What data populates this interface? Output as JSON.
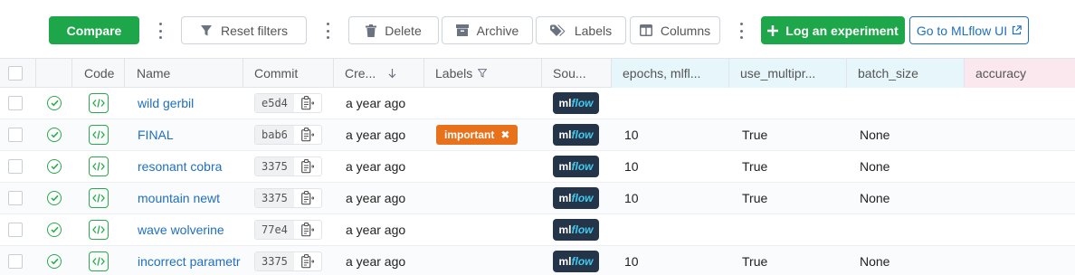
{
  "toolbar": {
    "compare": "Compare",
    "reset_filters": "Reset filters",
    "delete": "Delete",
    "archive": "Archive",
    "labels": "Labels",
    "columns": "Columns",
    "log_experiment": "Log an experiment",
    "go_mlflow": "Go to MLflow UI"
  },
  "columns": {
    "code": "Code",
    "name": "Name",
    "commit": "Commit",
    "created": "Cre...",
    "labels": "Labels",
    "source": "Sou...",
    "epochs": "epochs, mlfl...",
    "use_multi": "use_multipr...",
    "batch_size": "batch_size",
    "accuracy": "accuracy"
  },
  "rows": [
    {
      "name": "wild gerbil",
      "commit": "e5d4",
      "created": "a year ago",
      "label": "",
      "epochs": "",
      "use_multi": "",
      "batch_size": "",
      "accuracy": ""
    },
    {
      "name": "FINAL",
      "commit": "bab6",
      "created": "a year ago",
      "label": "important",
      "epochs": "10",
      "use_multi": "True",
      "batch_size": "None",
      "accuracy": ""
    },
    {
      "name": "resonant cobra",
      "commit": "3375",
      "created": "a year ago",
      "label": "",
      "epochs": "10",
      "use_multi": "True",
      "batch_size": "None",
      "accuracy": ""
    },
    {
      "name": "mountain newt",
      "commit": "3375",
      "created": "a year ago",
      "label": "",
      "epochs": "10",
      "use_multi": "True",
      "batch_size": "None",
      "accuracy": ""
    },
    {
      "name": "wave wolverine",
      "commit": "77e4",
      "created": "a year ago",
      "label": "",
      "epochs": "",
      "use_multi": "",
      "batch_size": "",
      "accuracy": ""
    },
    {
      "name": "incorrect parametr",
      "commit": "3375",
      "created": "a year ago",
      "label": "",
      "epochs": "10",
      "use_multi": "True",
      "batch_size": "None",
      "accuracy": ""
    }
  ],
  "source_logo": {
    "ml": "ml",
    "flow": "flow"
  },
  "label_remove_glyph": "✖",
  "colors": {
    "primary_green": "#1ea64a",
    "link_blue": "#1f6fbf",
    "label_orange": "#e8711c",
    "param_header": "#e6f6fa",
    "metric_header": "#fbe7ee"
  }
}
